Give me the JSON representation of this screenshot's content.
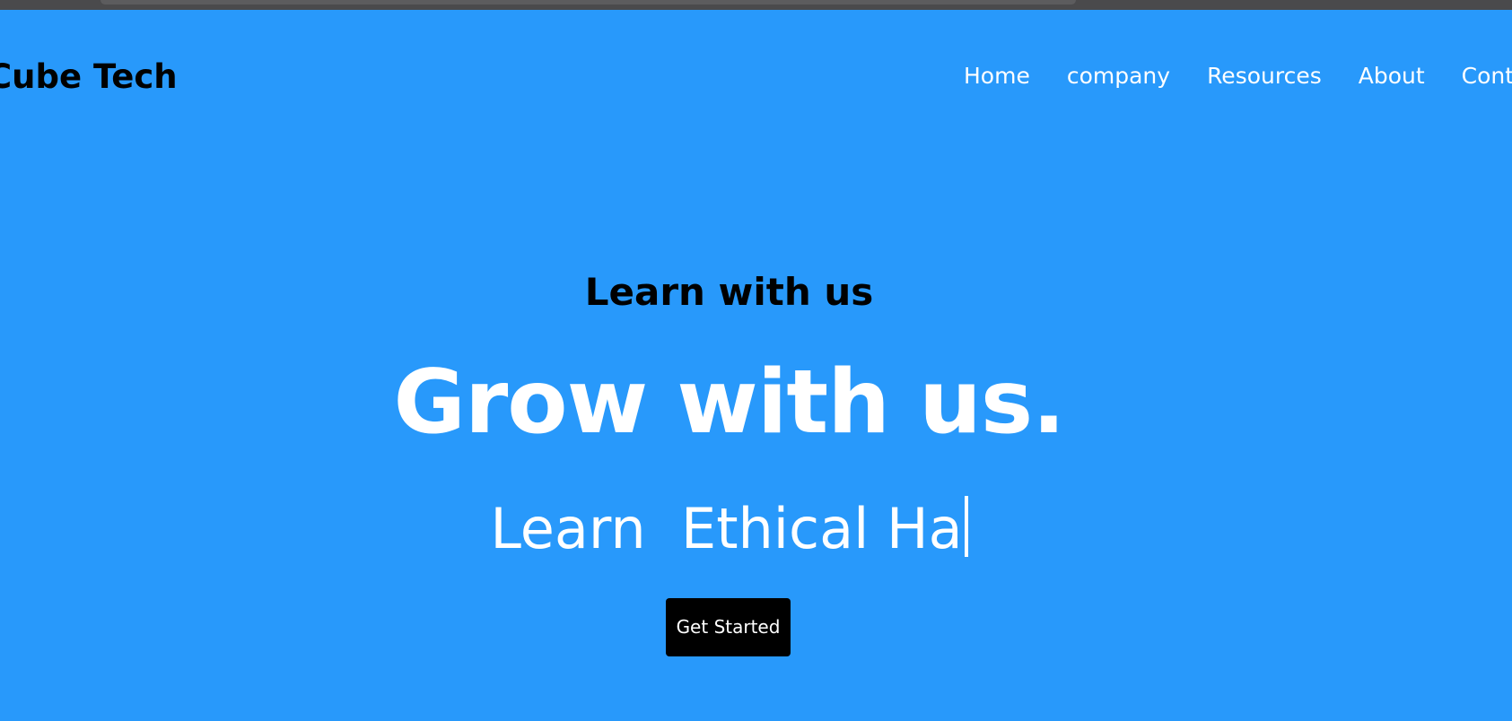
{
  "header": {
    "logo": "Cube Tech",
    "nav": [
      "Home",
      "company",
      "Resources",
      "About",
      "Contact"
    ]
  },
  "hero": {
    "subtitle": "Learn with us",
    "headline": "Grow with us.",
    "typed_text": "Learn  Ethical Ha",
    "cta_label": "Get Started"
  },
  "colors": {
    "background": "#2899fb",
    "text_dark": "#000000",
    "text_light": "#ffffff",
    "button_bg": "#000000"
  }
}
